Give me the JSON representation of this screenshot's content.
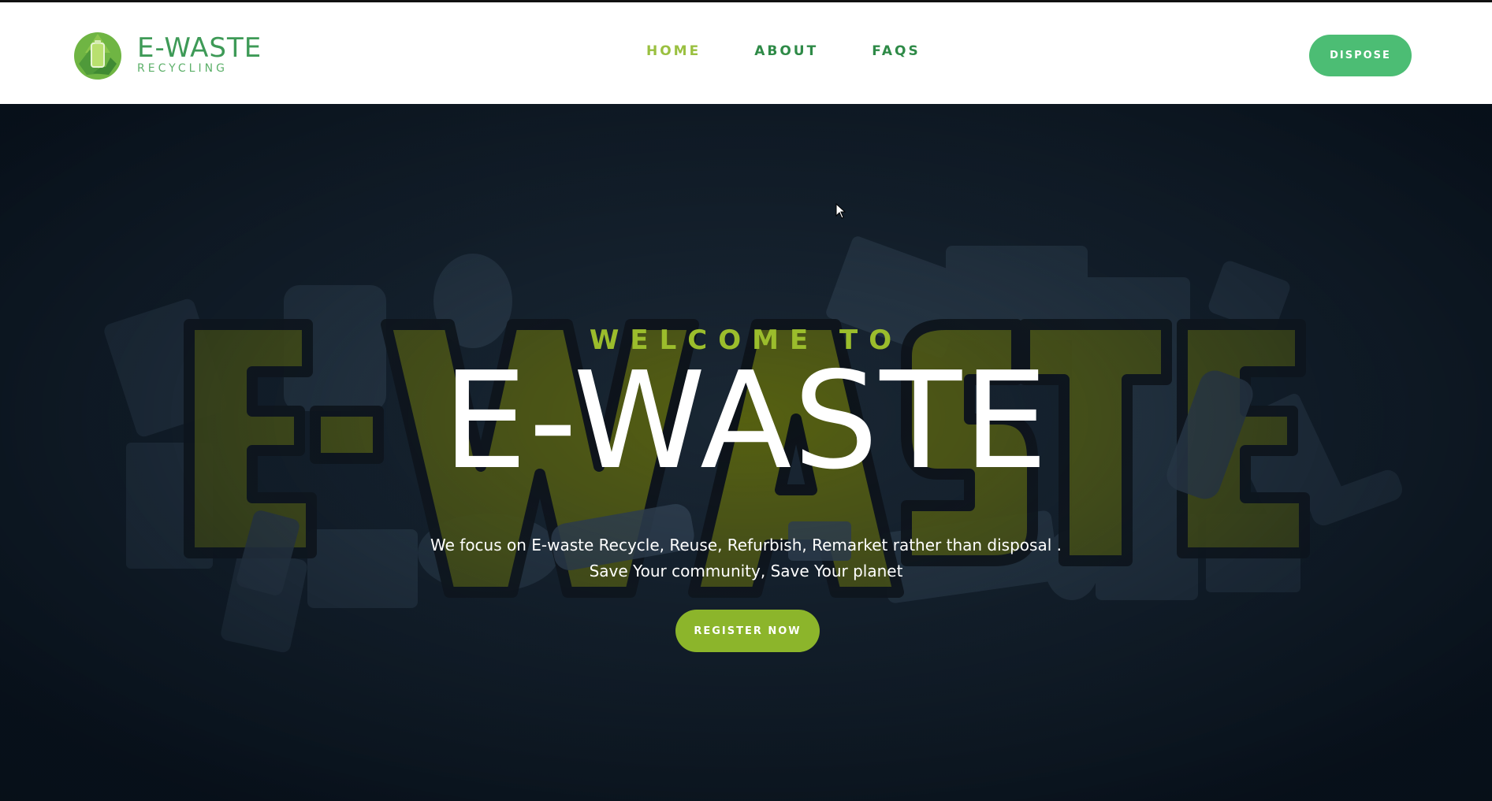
{
  "brand": {
    "title": "E-WASTE",
    "subtitle": "RECYCLING",
    "icon": "recycle-logo-icon"
  },
  "nav": {
    "items": [
      {
        "label": "HOME",
        "active": true
      },
      {
        "label": "ABOUT",
        "active": false
      },
      {
        "label": "FAQS",
        "active": false
      }
    ]
  },
  "header": {
    "cta_label": "DISPOSE"
  },
  "hero": {
    "welcome": "WELCOME TO",
    "title": "E-WASTE",
    "tagline_line1": "We focus on E-waste Recycle, Reuse, Refurbish, Remarket rather than disposal .",
    "tagline_line2": "Save Your community, Save Your planet",
    "cta_label": "REGISTER NOW",
    "background_text": "E-WASTE"
  },
  "colors": {
    "header_bg": "#ffffff",
    "nav_link": "#2e8a47",
    "nav_active": "#9ac040",
    "dispose_button": "#4cbd74",
    "register_button": "#8cb52b",
    "hero_bg": "#0d1823",
    "welcome_text": "#9bbd2c"
  }
}
